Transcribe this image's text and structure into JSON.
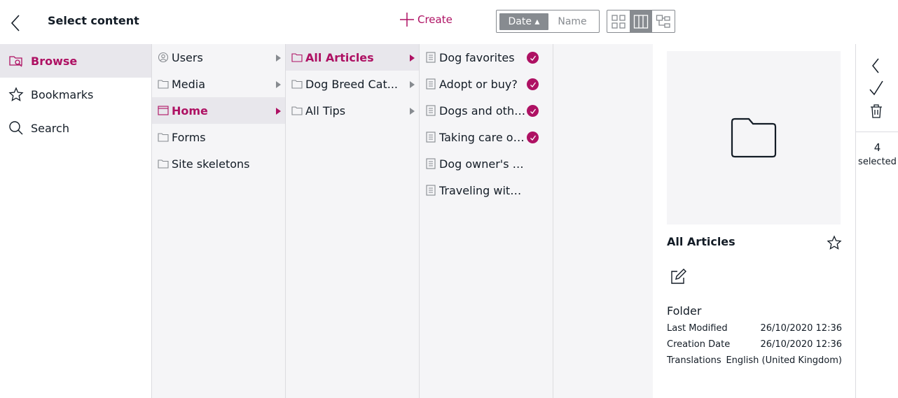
{
  "header": {
    "title": "Select content",
    "create_label": "Create",
    "sort": {
      "date_label": "Date ▴",
      "name_label": "Name",
      "active": "date"
    },
    "views": [
      "grid-view",
      "column-view",
      "tree-view"
    ],
    "active_view": "column-view"
  },
  "nav": {
    "items": [
      {
        "label": "Browse",
        "icon": "browse-icon"
      },
      {
        "label": "Bookmarks",
        "icon": "star-icon"
      },
      {
        "label": "Search",
        "icon": "search-icon"
      }
    ],
    "active": "Browse"
  },
  "columns": {
    "col1": [
      {
        "label": "Users",
        "icon": "users-icon"
      },
      {
        "label": "Media",
        "icon": "folder-icon"
      },
      {
        "label": "Home",
        "icon": "site-icon"
      },
      {
        "label": "Forms",
        "icon": "folder-icon"
      },
      {
        "label": "Site skeletons",
        "icon": "folder-icon"
      }
    ],
    "col2": [
      {
        "label": "All Articles",
        "icon": "folder-icon"
      },
      {
        "label": "Dog Breed Cat...",
        "icon": "folder-icon"
      },
      {
        "label": "All Tips",
        "icon": "folder-icon"
      }
    ],
    "col3": [
      {
        "label": "Dog favorites",
        "icon": "document-icon",
        "selected": true
      },
      {
        "label": "Adopt or buy?",
        "icon": "document-icon",
        "selected": true
      },
      {
        "label": "Dogs and othe...",
        "icon": "document-icon",
        "selected": true
      },
      {
        "label": "Taking care of ...",
        "icon": "document-icon",
        "selected": true
      },
      {
        "label": "Dog owner's fi...",
        "icon": "document-icon",
        "selected": false
      },
      {
        "label": "Traveling with ...",
        "icon": "document-icon",
        "selected": false
      }
    ]
  },
  "preview": {
    "name": "All Articles",
    "type": "Folder",
    "meta": [
      {
        "key": "Last Modified",
        "value": "26/10/2020 12:36"
      },
      {
        "key": "Creation Date",
        "value": "26/10/2020 12:36"
      },
      {
        "key": "Translations",
        "value": "English (United Kingdom)"
      }
    ]
  },
  "selection": {
    "count": "4",
    "label": "selected"
  },
  "colors": {
    "accent": "#ae1163",
    "panel": "#f5f5f7",
    "active_row": "#e8e7ec",
    "muted": "#878b90"
  }
}
